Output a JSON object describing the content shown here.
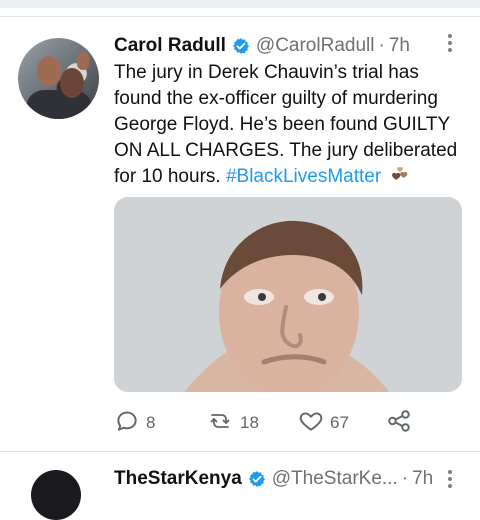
{
  "tweet": {
    "author_name": "Carol Radull",
    "handle": "@CarolRadull",
    "separator": "·",
    "time": "7h",
    "text_main": "The jury in Derek Chauvin’s trial has found the ex-officer guilty of murdering George Floyd. He’s been found GUILTY ON ALL CHARGES. The jury deliberated for 10 hours.",
    "hashtag": "#BlackLivesMatter",
    "emoji": "three-hearts-icon",
    "media": {
      "kind": "photo",
      "has_photo": true
    },
    "actions": {
      "replies": "8",
      "retweets": "18",
      "likes": "67"
    }
  },
  "next_tweet": {
    "author_name": "TheStarKenya",
    "handle": "@TheStarKe...",
    "separator": "·",
    "time": "7h"
  },
  "colors": {
    "accent": "#1d9bf0",
    "muted": "#6b7276"
  },
  "icons": {
    "reply": "reply-icon",
    "retweet": "retweet-icon",
    "like": "heart-icon",
    "share": "share-icon",
    "verified": "verified-badge-icon",
    "more": "kebab-menu-icon"
  }
}
